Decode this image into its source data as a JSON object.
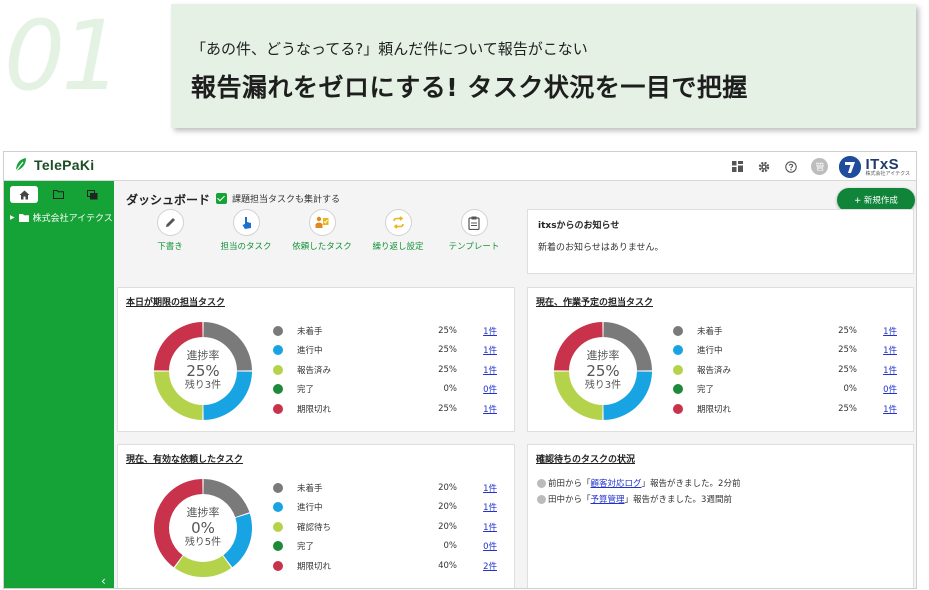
{
  "banner": {
    "number": "01",
    "subtitle": "「あの件、どうなってる?」頼んだ件について報告がこない",
    "headline": "報告漏れをゼロにする! タスク状況を一目で把握"
  },
  "app": {
    "name": "TelePaKi",
    "avatar": "管",
    "brand": "ITxS",
    "brand_sub": "株式会社アイテクス",
    "toolbar_icons": [
      "grid-icon",
      "gear-icon",
      "help-icon"
    ]
  },
  "sidebar": {
    "tree": [
      {
        "label": "株式会社アイテクス"
      }
    ],
    "collapse": "‹"
  },
  "dashboard": {
    "title": "ダッシュボード",
    "aggregate_label": "課題担当タスクも集計する",
    "aggregate_checked": true,
    "new_button": "+ 新規作成",
    "quick_actions": [
      {
        "label": "下書き",
        "icon": "pencil-icon",
        "color": "#555555"
      },
      {
        "label": "担当のタスク",
        "icon": "hand-pointer-icon",
        "color": "#1a6fd0"
      },
      {
        "label": "依頼したタスク",
        "icon": "person-task-icon",
        "color": "#e08a1e"
      },
      {
        "label": "繰り返し設定",
        "icon": "repeat-icon",
        "color": "#e8b818"
      },
      {
        "label": "テンプレート",
        "icon": "clipboard-icon",
        "color": "#555555"
      }
    ]
  },
  "notice": {
    "title": "itxsからのお知らせ",
    "text": "新着のお知らせはありません。"
  },
  "status_colors": {
    "未着手": "#7a7a7a",
    "進行中": "#18a3e2",
    "報告済み": "#b5d34a",
    "確認待ち": "#b5d34a",
    "完了": "#1d8a3a",
    "期限切れ": "#c8324a"
  },
  "panels": [
    {
      "title": "本日が期限の担当タスク",
      "donut": {
        "label": "進捗率",
        "percent": "25%",
        "remaining": "残り3件"
      },
      "rows": [
        {
          "name": "未着手",
          "pct": "25%",
          "count": "1件",
          "color": "#7a7a7a",
          "value": 25
        },
        {
          "name": "進行中",
          "pct": "25%",
          "count": "1件",
          "color": "#18a3e2",
          "value": 25
        },
        {
          "name": "報告済み",
          "pct": "25%",
          "count": "1件",
          "color": "#b5d34a",
          "value": 25
        },
        {
          "name": "完了",
          "pct": "0%",
          "count": "0件",
          "color": "#1d8a3a",
          "value": 0
        },
        {
          "name": "期限切れ",
          "pct": "25%",
          "count": "1件",
          "color": "#c8324a",
          "value": 25
        }
      ]
    },
    {
      "title": "現在、作業予定の担当タスク",
      "donut": {
        "label": "進捗率",
        "percent": "25%",
        "remaining": "残り3件"
      },
      "rows": [
        {
          "name": "未着手",
          "pct": "25%",
          "count": "1件",
          "color": "#7a7a7a",
          "value": 25
        },
        {
          "name": "進行中",
          "pct": "25%",
          "count": "1件",
          "color": "#18a3e2",
          "value": 25
        },
        {
          "name": "報告済み",
          "pct": "25%",
          "count": "1件",
          "color": "#b5d34a",
          "value": 25
        },
        {
          "name": "完了",
          "pct": "0%",
          "count": "0件",
          "color": "#1d8a3a",
          "value": 0
        },
        {
          "name": "期限切れ",
          "pct": "25%",
          "count": "1件",
          "color": "#c8324a",
          "value": 25
        }
      ]
    },
    {
      "title": "現在、有効な依頼したタスク",
      "donut": {
        "label": "進捗率",
        "percent": "0%",
        "remaining": "残り5件"
      },
      "rows": [
        {
          "name": "未着手",
          "pct": "20%",
          "count": "1件",
          "color": "#7a7a7a",
          "value": 20
        },
        {
          "name": "進行中",
          "pct": "20%",
          "count": "1件",
          "color": "#18a3e2",
          "value": 20
        },
        {
          "name": "確認待ち",
          "pct": "20%",
          "count": "1件",
          "color": "#b5d34a",
          "value": 20
        },
        {
          "name": "完了",
          "pct": "0%",
          "count": "0件",
          "color": "#1d8a3a",
          "value": 0
        },
        {
          "name": "期限切れ",
          "pct": "40%",
          "count": "2件",
          "color": "#c8324a",
          "value": 40
        }
      ]
    }
  ],
  "confirm": {
    "title": "確認待ちのタスクの状況",
    "items": [
      {
        "prefix": "前田から「",
        "link": "顧客対応ログ",
        "suffix": "」報告がきました。2分前"
      },
      {
        "prefix": "田中から「",
        "link": "予算管理",
        "suffix": "」報告がきました。3週間前"
      }
    ]
  }
}
